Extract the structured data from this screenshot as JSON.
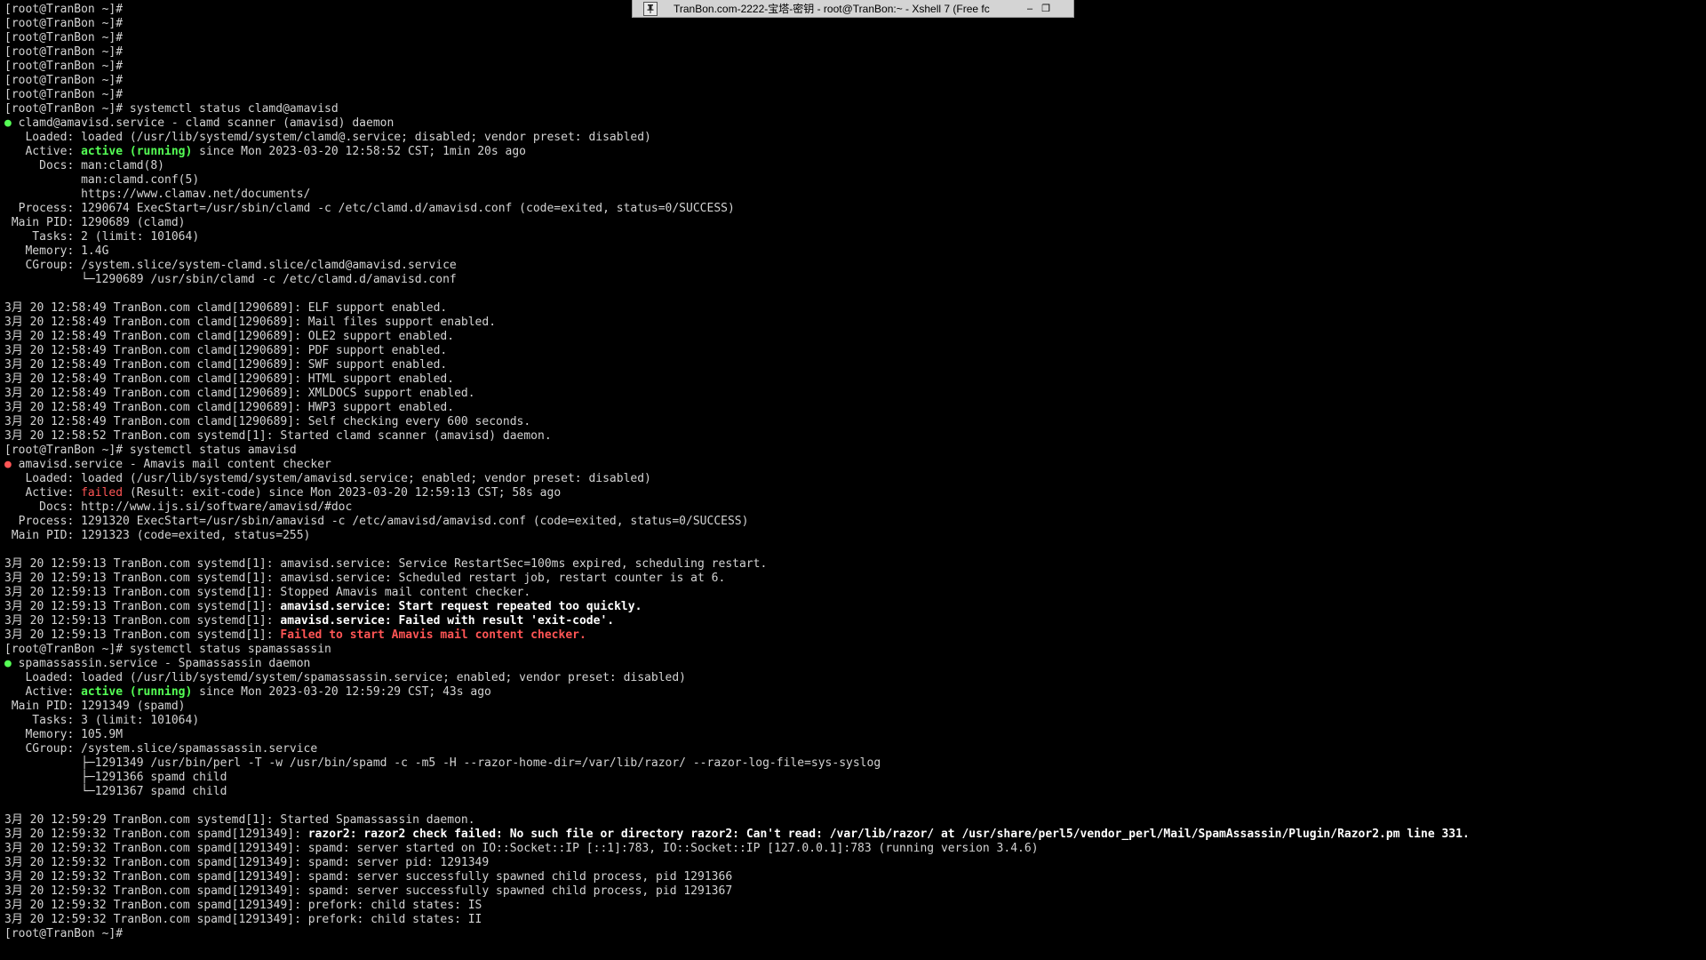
{
  "window": {
    "title": "TranBon.com-2222-宝塔-密钥 - root@TranBon:~ - Xshell 7 (Free fc",
    "pin_icon": "pin-icon",
    "minimize_label": "–",
    "restore_label": "❐"
  },
  "colors": {
    "background": "#000000",
    "text": "#d3d3d3",
    "active_green": "#55ff55",
    "failed_red": "#ff5555",
    "bold_white": "#ffffff"
  },
  "terminal": {
    "lines": [
      {
        "kind": "prompt",
        "segments": [
          {
            "text": "[root@TranBon ~]#"
          }
        ]
      },
      {
        "kind": "prompt",
        "segments": [
          {
            "text": "[root@TranBon ~]#"
          }
        ]
      },
      {
        "kind": "prompt",
        "segments": [
          {
            "text": "[root@TranBon ~]#"
          }
        ]
      },
      {
        "kind": "prompt",
        "segments": [
          {
            "text": "[root@TranBon ~]#"
          }
        ]
      },
      {
        "kind": "prompt",
        "segments": [
          {
            "text": "[root@TranBon ~]#"
          }
        ]
      },
      {
        "kind": "prompt",
        "segments": [
          {
            "text": "[root@TranBon ~]#"
          }
        ]
      },
      {
        "kind": "prompt",
        "segments": [
          {
            "text": "[root@TranBon ~]#"
          }
        ]
      },
      {
        "kind": "prompt",
        "segments": [
          {
            "text": "[root@TranBon ~]# systemctl status clamd@amavisd"
          }
        ]
      },
      {
        "kind": "output",
        "segments": [
          {
            "text": "●",
            "style": "dotgreen"
          },
          {
            "text": " clamd@amavisd.service - clamd scanner (amavisd) daemon"
          }
        ]
      },
      {
        "kind": "output",
        "segments": [
          {
            "text": "   Loaded: loaded (/usr/lib/systemd/system/clamd@.service; disabled; vendor preset: disabled)"
          }
        ]
      },
      {
        "kind": "output",
        "segments": [
          {
            "text": "   Active: "
          },
          {
            "text": "active (running)",
            "style": "green"
          },
          {
            "text": " since Mon 2023-03-20 12:58:52 CST; 1min 20s ago"
          }
        ]
      },
      {
        "kind": "output",
        "segments": [
          {
            "text": "     Docs: man:clamd(8)"
          }
        ]
      },
      {
        "kind": "output",
        "segments": [
          {
            "text": "           man:clamd.conf(5)"
          }
        ]
      },
      {
        "kind": "output",
        "segments": [
          {
            "text": "           https://www.clamav.net/documents/"
          }
        ]
      },
      {
        "kind": "output",
        "segments": [
          {
            "text": "  Process: 1290674 ExecStart=/usr/sbin/clamd -c /etc/clamd.d/amavisd.conf (code=exited, status=0/SUCCESS)"
          }
        ]
      },
      {
        "kind": "output",
        "segments": [
          {
            "text": " Main PID: 1290689 (clamd)"
          }
        ]
      },
      {
        "kind": "output",
        "segments": [
          {
            "text": "    Tasks: 2 (limit: 101064)"
          }
        ]
      },
      {
        "kind": "output",
        "segments": [
          {
            "text": "   Memory: 1.4G"
          }
        ]
      },
      {
        "kind": "output",
        "segments": [
          {
            "text": "   CGroup: /system.slice/system-clamd.slice/clamd@amavisd.service"
          }
        ]
      },
      {
        "kind": "output",
        "segments": [
          {
            "text": "           └─1290689 /usr/sbin/clamd -c /etc/clamd.d/amavisd.conf"
          }
        ]
      },
      {
        "kind": "blank",
        "segments": [
          {
            "text": ""
          }
        ]
      },
      {
        "kind": "log",
        "segments": [
          {
            "text": "3月 20 12:58:49 TranBon.com clamd[1290689]: ELF support enabled."
          }
        ]
      },
      {
        "kind": "log",
        "segments": [
          {
            "text": "3月 20 12:58:49 TranBon.com clamd[1290689]: Mail files support enabled."
          }
        ]
      },
      {
        "kind": "log",
        "segments": [
          {
            "text": "3月 20 12:58:49 TranBon.com clamd[1290689]: OLE2 support enabled."
          }
        ]
      },
      {
        "kind": "log",
        "segments": [
          {
            "text": "3月 20 12:58:49 TranBon.com clamd[1290689]: PDF support enabled."
          }
        ]
      },
      {
        "kind": "log",
        "segments": [
          {
            "text": "3月 20 12:58:49 TranBon.com clamd[1290689]: SWF support enabled."
          }
        ]
      },
      {
        "kind": "log",
        "segments": [
          {
            "text": "3月 20 12:58:49 TranBon.com clamd[1290689]: HTML support enabled."
          }
        ]
      },
      {
        "kind": "log",
        "segments": [
          {
            "text": "3月 20 12:58:49 TranBon.com clamd[1290689]: XMLDOCS support enabled."
          }
        ]
      },
      {
        "kind": "log",
        "segments": [
          {
            "text": "3月 20 12:58:49 TranBon.com clamd[1290689]: HWP3 support enabled."
          }
        ]
      },
      {
        "kind": "log",
        "segments": [
          {
            "text": "3月 20 12:58:49 TranBon.com clamd[1290689]: Self checking every 600 seconds."
          }
        ]
      },
      {
        "kind": "log",
        "segments": [
          {
            "text": "3月 20 12:58:52 TranBon.com systemd[1]: Started clamd scanner (amavisd) daemon."
          }
        ]
      },
      {
        "kind": "prompt",
        "segments": [
          {
            "text": "[root@TranBon ~]# systemctl status amavisd"
          }
        ]
      },
      {
        "kind": "output",
        "segments": [
          {
            "text": "●",
            "style": "dotred"
          },
          {
            "text": " amavisd.service - Amavis mail content checker"
          }
        ]
      },
      {
        "kind": "output",
        "segments": [
          {
            "text": "   Loaded: loaded (/usr/lib/systemd/system/amavisd.service; enabled; vendor preset: disabled)"
          }
        ]
      },
      {
        "kind": "output",
        "segments": [
          {
            "text": "   Active: "
          },
          {
            "text": "failed",
            "style": "red"
          },
          {
            "text": " (Result: exit-code) since Mon 2023-03-20 12:59:13 CST; 58s ago"
          }
        ]
      },
      {
        "kind": "output",
        "segments": [
          {
            "text": "     Docs: http://www.ijs.si/software/amavisd/#doc"
          }
        ]
      },
      {
        "kind": "output",
        "segments": [
          {
            "text": "  Process: 1291320 ExecStart=/usr/sbin/amavisd -c /etc/amavisd/amavisd.conf (code=exited, status=0/SUCCESS)"
          }
        ]
      },
      {
        "kind": "output",
        "segments": [
          {
            "text": " Main PID: 1291323 (code=exited, status=255)"
          }
        ]
      },
      {
        "kind": "blank",
        "segments": [
          {
            "text": ""
          }
        ]
      },
      {
        "kind": "log",
        "segments": [
          {
            "text": "3月 20 12:59:13 TranBon.com systemd[1]: amavisd.service: Service RestartSec=100ms expired, scheduling restart."
          }
        ]
      },
      {
        "kind": "log",
        "segments": [
          {
            "text": "3月 20 12:59:13 TranBon.com systemd[1]: amavisd.service: Scheduled restart job, restart counter is at 6."
          }
        ]
      },
      {
        "kind": "log",
        "segments": [
          {
            "text": "3月 20 12:59:13 TranBon.com systemd[1]: Stopped Amavis mail content checker."
          }
        ]
      },
      {
        "kind": "log",
        "segments": [
          {
            "text": "3月 20 12:59:13 TranBon.com systemd[1]: "
          },
          {
            "text": "amavisd.service: Start request repeated too quickly.",
            "style": "bold"
          }
        ]
      },
      {
        "kind": "log",
        "segments": [
          {
            "text": "3月 20 12:59:13 TranBon.com systemd[1]: "
          },
          {
            "text": "amavisd.service: Failed with result 'exit-code'.",
            "style": "bold"
          }
        ]
      },
      {
        "kind": "log",
        "segments": [
          {
            "text": "3月 20 12:59:13 TranBon.com systemd[1]: "
          },
          {
            "text": "Failed to start Amavis mail content checker.",
            "style": "redbold"
          }
        ]
      },
      {
        "kind": "prompt",
        "segments": [
          {
            "text": "[root@TranBon ~]# systemctl status spamassassin"
          }
        ]
      },
      {
        "kind": "output",
        "segments": [
          {
            "text": "●",
            "style": "dotgreen"
          },
          {
            "text": " spamassassin.service - Spamassassin daemon"
          }
        ]
      },
      {
        "kind": "output",
        "segments": [
          {
            "text": "   Loaded: loaded (/usr/lib/systemd/system/spamassassin.service; enabled; vendor preset: disabled)"
          }
        ]
      },
      {
        "kind": "output",
        "segments": [
          {
            "text": "   Active: "
          },
          {
            "text": "active (running)",
            "style": "green"
          },
          {
            "text": " since Mon 2023-03-20 12:59:29 CST; 43s ago"
          }
        ]
      },
      {
        "kind": "output",
        "segments": [
          {
            "text": " Main PID: 1291349 (spamd)"
          }
        ]
      },
      {
        "kind": "output",
        "segments": [
          {
            "text": "    Tasks: 3 (limit: 101064)"
          }
        ]
      },
      {
        "kind": "output",
        "segments": [
          {
            "text": "   Memory: 105.9M"
          }
        ]
      },
      {
        "kind": "output",
        "segments": [
          {
            "text": "   CGroup: /system.slice/spamassassin.service"
          }
        ]
      },
      {
        "kind": "output",
        "segments": [
          {
            "text": "           ├─1291349 /usr/bin/perl -T -w /usr/bin/spamd -c -m5 -H --razor-home-dir=/var/lib/razor/ --razor-log-file=sys-syslog"
          }
        ]
      },
      {
        "kind": "output",
        "segments": [
          {
            "text": "           ├─1291366 spamd child"
          }
        ]
      },
      {
        "kind": "output",
        "segments": [
          {
            "text": "           └─1291367 spamd child"
          }
        ]
      },
      {
        "kind": "blank",
        "segments": [
          {
            "text": ""
          }
        ]
      },
      {
        "kind": "log",
        "segments": [
          {
            "text": "3月 20 12:59:29 TranBon.com systemd[1]: Started Spamassassin daemon."
          }
        ]
      },
      {
        "kind": "log",
        "segments": [
          {
            "text": "3月 20 12:59:32 TranBon.com spamd[1291349]: "
          },
          {
            "text": "razor2: razor2 check failed: No such file or directory razor2: Can't read: /var/lib/razor/ at /usr/share/perl5/vendor_perl/Mail/SpamAssassin/Plugin/Razor2.pm line 331.",
            "style": "bold"
          }
        ]
      },
      {
        "kind": "log",
        "segments": [
          {
            "text": "3月 20 12:59:32 TranBon.com spamd[1291349]: spamd: server started on IO::Socket::IP [::1]:783, IO::Socket::IP [127.0.0.1]:783 (running version 3.4.6)"
          }
        ]
      },
      {
        "kind": "log",
        "segments": [
          {
            "text": "3月 20 12:59:32 TranBon.com spamd[1291349]: spamd: server pid: 1291349"
          }
        ]
      },
      {
        "kind": "log",
        "segments": [
          {
            "text": "3月 20 12:59:32 TranBon.com spamd[1291349]: spamd: server successfully spawned child process, pid 1291366"
          }
        ]
      },
      {
        "kind": "log",
        "segments": [
          {
            "text": "3月 20 12:59:32 TranBon.com spamd[1291349]: spamd: server successfully spawned child process, pid 1291367"
          }
        ]
      },
      {
        "kind": "log",
        "segments": [
          {
            "text": "3月 20 12:59:32 TranBon.com spamd[1291349]: prefork: child states: IS"
          }
        ]
      },
      {
        "kind": "log",
        "segments": [
          {
            "text": "3月 20 12:59:32 TranBon.com spamd[1291349]: prefork: child states: II"
          }
        ]
      },
      {
        "kind": "prompt",
        "segments": [
          {
            "text": "[root@TranBon ~]#"
          }
        ]
      }
    ]
  }
}
